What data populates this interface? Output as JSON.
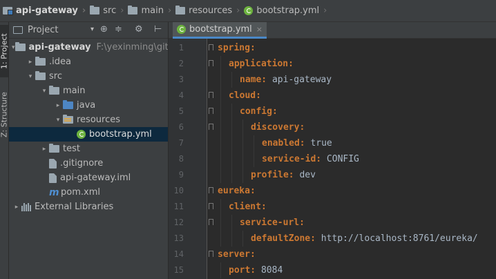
{
  "breadcrumb": [
    {
      "label": "api-gateway",
      "icon": "module-icon"
    },
    {
      "label": "src",
      "icon": "folder-icon"
    },
    {
      "label": "main",
      "icon": "folder-icon"
    },
    {
      "label": "resources",
      "icon": "folder-icon"
    },
    {
      "label": "bootstrap.yml",
      "icon": "spring-icon"
    }
  ],
  "toolwindows": [
    {
      "label": "1: Project"
    },
    {
      "label": "Z: Structure"
    }
  ],
  "project_panel": {
    "title": "Project",
    "dropdown": "▾",
    "tools": [
      "⊕",
      "≑",
      "⚙",
      "⊢"
    ]
  },
  "tree": [
    {
      "label": "api-gateway",
      "path": "F:\\yexinming\\githu",
      "arrow": "▾",
      "icon": "module",
      "indent": 0,
      "bold": true
    },
    {
      "label": ".idea",
      "arrow": "▸",
      "icon": "folder",
      "indent": 1
    },
    {
      "label": "src",
      "arrow": "▾",
      "icon": "folder",
      "indent": 1
    },
    {
      "label": "main",
      "arrow": "▾",
      "icon": "folder",
      "indent": 2
    },
    {
      "label": "java",
      "arrow": "▸",
      "icon": "folder-blue",
      "indent": 3
    },
    {
      "label": "resources",
      "arrow": "▾",
      "icon": "folder-res",
      "indent": 3
    },
    {
      "label": "bootstrap.yml",
      "arrow": "",
      "icon": "spring",
      "indent": 4,
      "selected": true
    },
    {
      "label": "test",
      "arrow": "▸",
      "icon": "folder",
      "indent": 2
    },
    {
      "label": ".gitignore",
      "arrow": "",
      "icon": "file",
      "indent": 2
    },
    {
      "label": "api-gateway.iml",
      "arrow": "",
      "icon": "file",
      "indent": 2
    },
    {
      "label": "pom.xml",
      "arrow": "",
      "icon": "maven",
      "indent": 2
    },
    {
      "label": "External Libraries",
      "arrow": "▸",
      "icon": "library",
      "indent": 0
    }
  ],
  "editor": {
    "tab_label": "bootstrap.yml",
    "tab_close": "×",
    "lines": [
      {
        "n": "1",
        "indent": 0,
        "key": "spring:",
        "value": ""
      },
      {
        "n": "2",
        "indent": 1,
        "key": "application:",
        "value": ""
      },
      {
        "n": "3",
        "indent": 2,
        "key": "name:",
        "value": " api-gateway"
      },
      {
        "n": "4",
        "indent": 1,
        "key": "cloud:",
        "value": ""
      },
      {
        "n": "5",
        "indent": 2,
        "key": "config:",
        "value": ""
      },
      {
        "n": "6",
        "indent": 3,
        "key": "discovery:",
        "value": ""
      },
      {
        "n": "7",
        "indent": 4,
        "key": "enabled:",
        "value": " true"
      },
      {
        "n": "8",
        "indent": 4,
        "key": "service-id:",
        "value": " CONFIG"
      },
      {
        "n": "9",
        "indent": 3,
        "key": "profile:",
        "value": " dev"
      },
      {
        "n": "10",
        "indent": 0,
        "key": "eureka:",
        "value": ""
      },
      {
        "n": "11",
        "indent": 1,
        "key": "client:",
        "value": ""
      },
      {
        "n": "12",
        "indent": 2,
        "key": "service-url:",
        "value": ""
      },
      {
        "n": "13",
        "indent": 3,
        "key": "defaultZone:",
        "value": " http://localhost:8761/eureka/"
      },
      {
        "n": "14",
        "indent": 0,
        "key": "server:",
        "value": ""
      },
      {
        "n": "15",
        "indent": 1,
        "key": "port:",
        "value": " 8084"
      }
    ]
  },
  "colors": {
    "panel_bg": "#3c3f41",
    "editor_bg": "#2b2b2b",
    "selection": "#0d293e",
    "yaml_key": "#cc7832",
    "yaml_value": "#a9b7c6",
    "spring_green": "#6db33f"
  }
}
